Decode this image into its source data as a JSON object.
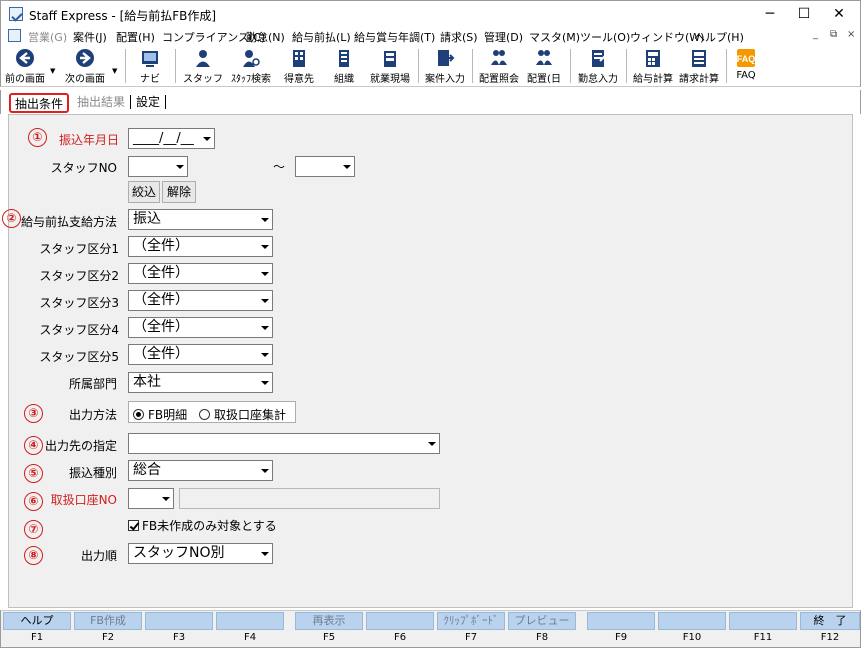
{
  "window": {
    "title": "Staff Express - [給与前払FB作成]"
  },
  "menu": [
    {
      "label": "営業(G)",
      "dim": true
    },
    {
      "label": "案件(J)"
    },
    {
      "label": "配置(H)"
    },
    {
      "label": "コンプライアンス(C)"
    },
    {
      "label": "勤怠(N)"
    },
    {
      "label": "給与前払(L)"
    },
    {
      "label": "給与賞与年調(T)"
    },
    {
      "label": "請求(S)"
    },
    {
      "label": "管理(D)"
    },
    {
      "label": "マスタ(M)"
    },
    {
      "label": "ツール(O)"
    },
    {
      "label": "ウィンドウ(W)"
    },
    {
      "label": "ヘルプ(H)"
    }
  ],
  "toolbar": [
    {
      "label": "前の画面",
      "icon": "back-arrow-icon"
    },
    {
      "label": "次の画面",
      "icon": "forward-arrow-icon"
    },
    {
      "label": "ナビ",
      "icon": "navi-icon"
    },
    {
      "label": "スタッフ",
      "icon": "staff-icon"
    },
    {
      "label": "ｽﾀｯﾌ検索",
      "icon": "staff-search-icon"
    },
    {
      "label": "得意先",
      "icon": "customer-icon"
    },
    {
      "label": "組織",
      "icon": "organization-icon"
    },
    {
      "label": "就業現場",
      "icon": "worksite-icon"
    },
    {
      "label": "案件入力",
      "icon": "case-input-icon"
    },
    {
      "label": "配置照会",
      "icon": "placement-inquiry-icon"
    },
    {
      "label": "配置(日",
      "icon": "placement-daily-icon"
    },
    {
      "label": "勤怠入力",
      "icon": "attendance-input-icon"
    },
    {
      "label": "給与計算",
      "icon": "salary-calc-icon"
    },
    {
      "label": "請求計算",
      "icon": "billing-calc-icon"
    },
    {
      "label": "FAQ",
      "icon": "faq-icon"
    }
  ],
  "tabs": [
    {
      "label": "抽出条件",
      "active": true
    },
    {
      "label": "抽出結果",
      "dim": true
    },
    {
      "label": "設定"
    }
  ],
  "form": {
    "markers": [
      "①",
      "②",
      "③",
      "④",
      "⑤",
      "⑥",
      "⑦",
      "⑧"
    ],
    "transfer_date": {
      "label": "振込年月日",
      "value": "____/__/__"
    },
    "staff_no": {
      "label": "スタッフNO",
      "from": "",
      "to": "",
      "tilde": "～"
    },
    "filter_button": "絞込",
    "clear_button": "解除",
    "pay_method": {
      "label": "給与前払支給方法",
      "value": "振込"
    },
    "staff_div": [
      {
        "label": "スタッフ区分1",
        "value": "（全件）"
      },
      {
        "label": "スタッフ区分2",
        "value": "（全件）"
      },
      {
        "label": "スタッフ区分3",
        "value": "（全件）"
      },
      {
        "label": "スタッフ区分4",
        "value": "（全件）"
      },
      {
        "label": "スタッフ区分5",
        "value": "（全件）"
      }
    ],
    "department": {
      "label": "所属部門",
      "value": "本社"
    },
    "output_method": {
      "label": "出力方法",
      "options": [
        "FB明細",
        "取扱口座集計"
      ],
      "selected": 0
    },
    "output_dest": {
      "label": "出力先の指定",
      "value": ""
    },
    "transfer_type": {
      "label": "振込種別",
      "value": "総合"
    },
    "account_no": {
      "label": "取扱口座NO",
      "value": "",
      "name": ""
    },
    "unprocessed_only": {
      "label": "FB未作成のみ対象とする",
      "checked": true
    },
    "output_order": {
      "label": "出力順",
      "value": "スタッフNO別"
    }
  },
  "fkeys": [
    {
      "key": "F1",
      "label": "ヘルプ"
    },
    {
      "key": "F2",
      "label": "FB作成",
      "dim": true
    },
    {
      "key": "F3",
      "label": ""
    },
    {
      "key": "F4",
      "label": ""
    },
    {
      "key": "F5",
      "label": "再表示",
      "dim": true
    },
    {
      "key": "F6",
      "label": ""
    },
    {
      "key": "F7",
      "label": "ｸﾘｯﾌﾟﾎﾞｰﾄﾞ",
      "dim": true
    },
    {
      "key": "F8",
      "label": "プレビュー",
      "dim": true
    },
    {
      "key": "F9",
      "label": ""
    },
    {
      "key": "F10",
      "label": ""
    },
    {
      "key": "F11",
      "label": ""
    },
    {
      "key": "F12",
      "label": "終　了"
    }
  ]
}
